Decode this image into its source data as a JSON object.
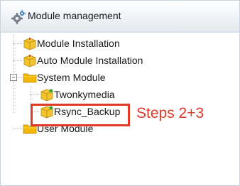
{
  "panel": {
    "title": "Module management",
    "header_icon": "gear-icon"
  },
  "tree": {
    "items": [
      {
        "label": "Module Installation",
        "icon": "package-icon"
      },
      {
        "label": "Auto Module Installation",
        "icon": "package-icon"
      },
      {
        "label": "System Module",
        "icon": "folder-icon",
        "expanded": true,
        "children": [
          {
            "label": "Twonkymedia",
            "icon": "package-icon"
          },
          {
            "label": "Rsync_Backup",
            "icon": "package-icon"
          }
        ]
      },
      {
        "label": "User Module",
        "icon": "folder-icon"
      }
    ]
  },
  "annotation": {
    "text": "Steps 2+3",
    "color": "#e23a28"
  }
}
